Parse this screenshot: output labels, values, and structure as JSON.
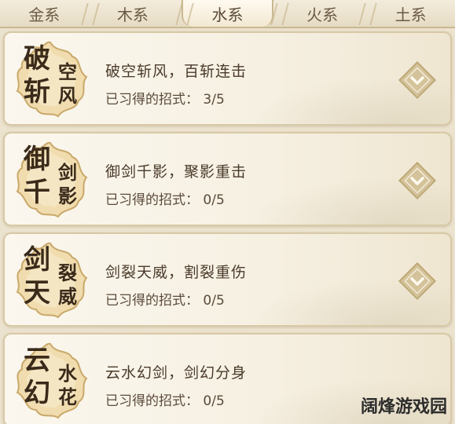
{
  "tabs": [
    {
      "label": "金系",
      "active": false
    },
    {
      "label": "木系",
      "active": false
    },
    {
      "label": "水系",
      "active": true
    },
    {
      "label": "火系",
      "active": false
    },
    {
      "label": "土系",
      "active": false
    }
  ],
  "skills": [
    {
      "emblem": [
        "破",
        "斩",
        "空",
        "风"
      ],
      "title": "破空斩风，百斩连击",
      "progress_label": "已习得的招式：",
      "progress": "3/5"
    },
    {
      "emblem": [
        "御",
        "千",
        "剑",
        "影"
      ],
      "title": "御剑千影，聚影重击",
      "progress_label": "已习得的招式：",
      "progress": "0/5"
    },
    {
      "emblem": [
        "剑",
        "天",
        "裂",
        "威"
      ],
      "title": "剑裂天威，割裂重伤",
      "progress_label": "已习得的招式：",
      "progress": "0/5"
    },
    {
      "emblem": [
        "云",
        "幻",
        "水",
        "花"
      ],
      "title": "云水幻剑，剑幻分身",
      "progress_label": "已习得的招式：",
      "progress": "0/5"
    }
  ],
  "watermark": "阔烽游戏园"
}
